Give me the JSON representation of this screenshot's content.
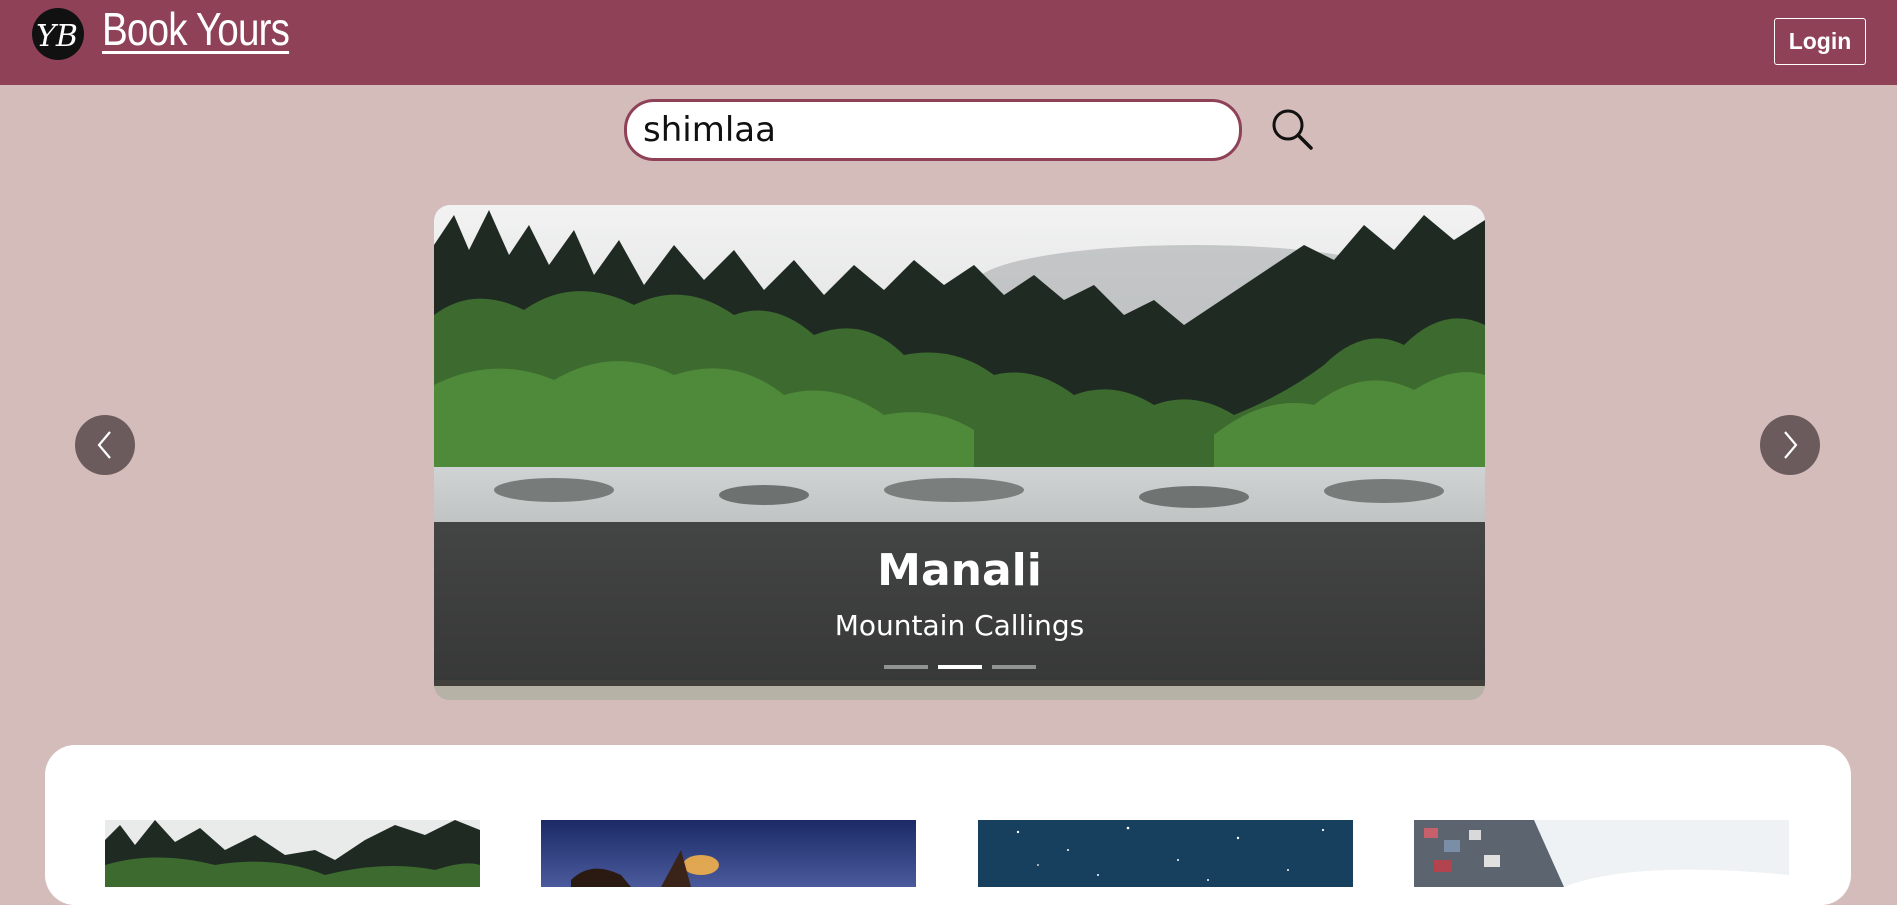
{
  "header": {
    "logo_text": "YB",
    "brand": "Book Yours",
    "login_label": "Login"
  },
  "search": {
    "value": "shimlaa",
    "icon": "search-icon"
  },
  "carousel": {
    "slides": [
      {
        "title": "Manali",
        "subtitle": "Mountain Callings"
      }
    ],
    "indicator_count": 3,
    "active_index": 1,
    "prev_icon": "chevron-left-icon",
    "next_icon": "chevron-right-icon"
  },
  "cards": [
    {
      "image": "forest-river-image"
    },
    {
      "image": "night-festival-image"
    },
    {
      "image": "starry-sky-image"
    },
    {
      "image": "snowy-town-image"
    }
  ],
  "colors": {
    "header_bg": "#8e4157",
    "page_bg": "#d4bcba",
    "accent": "#8e4157"
  }
}
